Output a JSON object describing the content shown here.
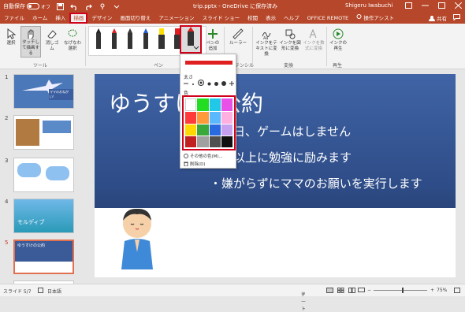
{
  "titlebar": {
    "autosave_label": "自動保存",
    "autosave_state": "オフ",
    "doc_title": "trip.pptx - OneDrive に保存済み",
    "user_name": "Shigeru Iwabuchi",
    "bg_color": "#b7472a"
  },
  "tabs": [
    "ファイル",
    "ホーム",
    "挿入",
    "描画",
    "デザイン",
    "画面切り替え",
    "アニメーション",
    "スライド ショー",
    "校閲",
    "表示",
    "ヘルプ",
    "OFFICE REMOTE",
    "操作アシスト"
  ],
  "active_tab": "描画",
  "share_label": "共有",
  "ribbon": {
    "select_label": "選択",
    "touch_draw_label": "タッチして描画する",
    "eraser_label": "消しゴム",
    "lasso_label": "なげなわ選択",
    "tools_group": "ツール",
    "pen_add_label": "ペンの追加",
    "ruler_label": "ルーラー",
    "pens_group": "ペン",
    "stencil_group": "ステンシル",
    "ink_to_text_label": "インクをテキストに変換",
    "ink_to_shape_label": "インクを図形に変換",
    "ink_to_math_label": "インクを数式に変換",
    "convert_group": "変換",
    "ink_replay_label": "インクの再生",
    "replay_group": "再生"
  },
  "pens": [
    {
      "color": "#222222"
    },
    {
      "color": "#e02020"
    },
    {
      "color": "#3a3a3a"
    },
    {
      "color": "#2060d0"
    },
    {
      "color": "#ffe000"
    },
    {
      "color": "#e02020"
    },
    {
      "color": "#e02020"
    }
  ],
  "dropdown": {
    "thickness_label": "太さ",
    "color_label": "色",
    "more_colors_label": "その他の色(M)...",
    "effects_label": "削除(D)",
    "current_color": "#e02020",
    "colors": [
      "#ffffff",
      "#22dd22",
      "#22c8e8",
      "#e850e8",
      "#ff3a3a",
      "#ff9a3a",
      "#5ab8ff",
      "#ffb0e0",
      "#ffd800",
      "#3aa83a",
      "#2a6ae0",
      "#c8a0f0",
      "#c02020",
      "#a0a0a0",
      "#505050",
      "#101010"
    ]
  },
  "slide": {
    "title": "ゆうすけの公約",
    "bullets": [
      "日、ゲームはしません",
      "以上に勉強に励みます",
      "・嫌がらずにママのお願いを実行します"
    ]
  },
  "thumbs": [
    {
      "num": "1",
      "text": "ママのおねがい!"
    },
    {
      "num": "2",
      "text": ""
    },
    {
      "num": "3",
      "text": ""
    },
    {
      "num": "4",
      "text": "モルディブ"
    },
    {
      "num": "5",
      "text": "ゆうすけの公約"
    }
  ],
  "statusbar": {
    "slide_info": "スライド 5/7",
    "language": "日本語",
    "notes_label": "ノート",
    "zoom": "75%"
  }
}
